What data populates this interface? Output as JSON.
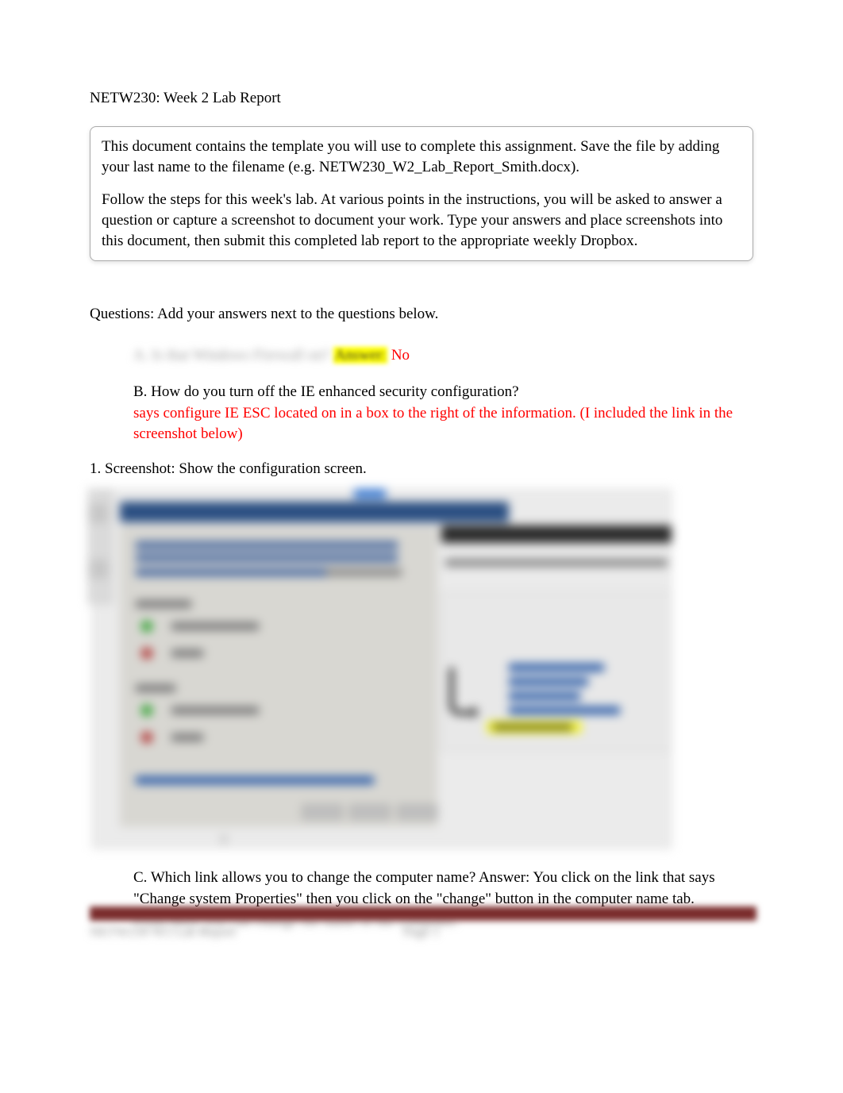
{
  "header": {
    "title": "NETW230: Week 2 Lab Report"
  },
  "instructions": {
    "p1": "This document contains the template you will use to complete this assignment. Save the file by adding your last name to the filename (e.g. NETW230_W2_Lab_Report_Smith.docx).",
    "p2": "Follow the steps for this week's lab. At various points in the instructions, you will be asked to answer a question or capture a screenshot to document your work. Type your answers and place screenshots into this document, then submit this completed lab report to the appropriate weekly Dropbox."
  },
  "questions_intro": "Questions: Add your answers next to the questions below.",
  "qa": {
    "a": {
      "blurred_question": "A. Is that Windows Firewall on?",
      "highlighted": "Answer:",
      "answer": " No"
    },
    "b": {
      "question": "B. How do you turn off the IE enhanced security configuration?",
      "answer": "says configure IE ESC located on in a box to the right of the information. (I included the link in the screenshot below)"
    }
  },
  "screenshot_label": "1. Screenshot: Show the configuration screen.",
  "qc": {
    "text": "C. Which link allows you to change the computer name?        Answer:   You click on the link that says \"Change system Properties\" then you click on the \"change\" button in the computer name tab.",
    "blurred": "From there you can change the name of the computer."
  },
  "footer": {
    "left": "NETW230 W2 Lab Report",
    "page": "Page 1"
  }
}
